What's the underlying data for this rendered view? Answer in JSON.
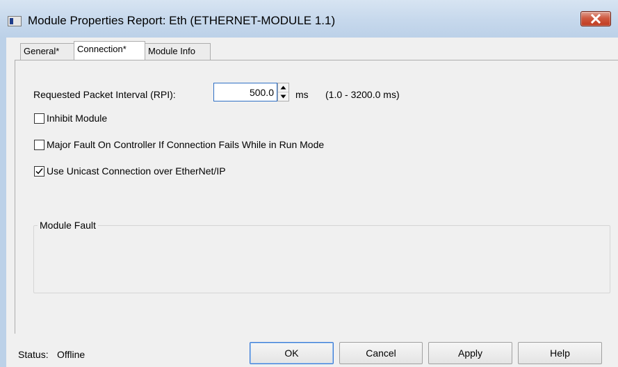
{
  "window": {
    "title": "Module Properties Report: Eth (ETHERNET-MODULE 1.1)",
    "close_icon": "close-icon",
    "close_color": "#c9432a"
  },
  "tabs": [
    {
      "label": "General*",
      "active": false
    },
    {
      "label": "Connection*",
      "active": true
    },
    {
      "label": "Module Info",
      "active": false
    }
  ],
  "rpi": {
    "label": "Requested Packet Interval (RPI):",
    "value": "500.0",
    "unit": "ms",
    "range": "(1.0 - 3200.0 ms)"
  },
  "options": [
    {
      "label": "Inhibit Module",
      "checked": false
    },
    {
      "label": "Major Fault On Controller If Connection Fails While in Run Mode",
      "checked": false
    },
    {
      "label": "Use Unicast Connection over EtherNet/IP",
      "checked": true
    }
  ],
  "module_fault": {
    "title": "Module Fault"
  },
  "status": {
    "label": "Status:",
    "value": "Offline"
  },
  "buttons": {
    "ok": "OK",
    "cancel": "Cancel",
    "apply": "Apply",
    "help": "Help"
  }
}
